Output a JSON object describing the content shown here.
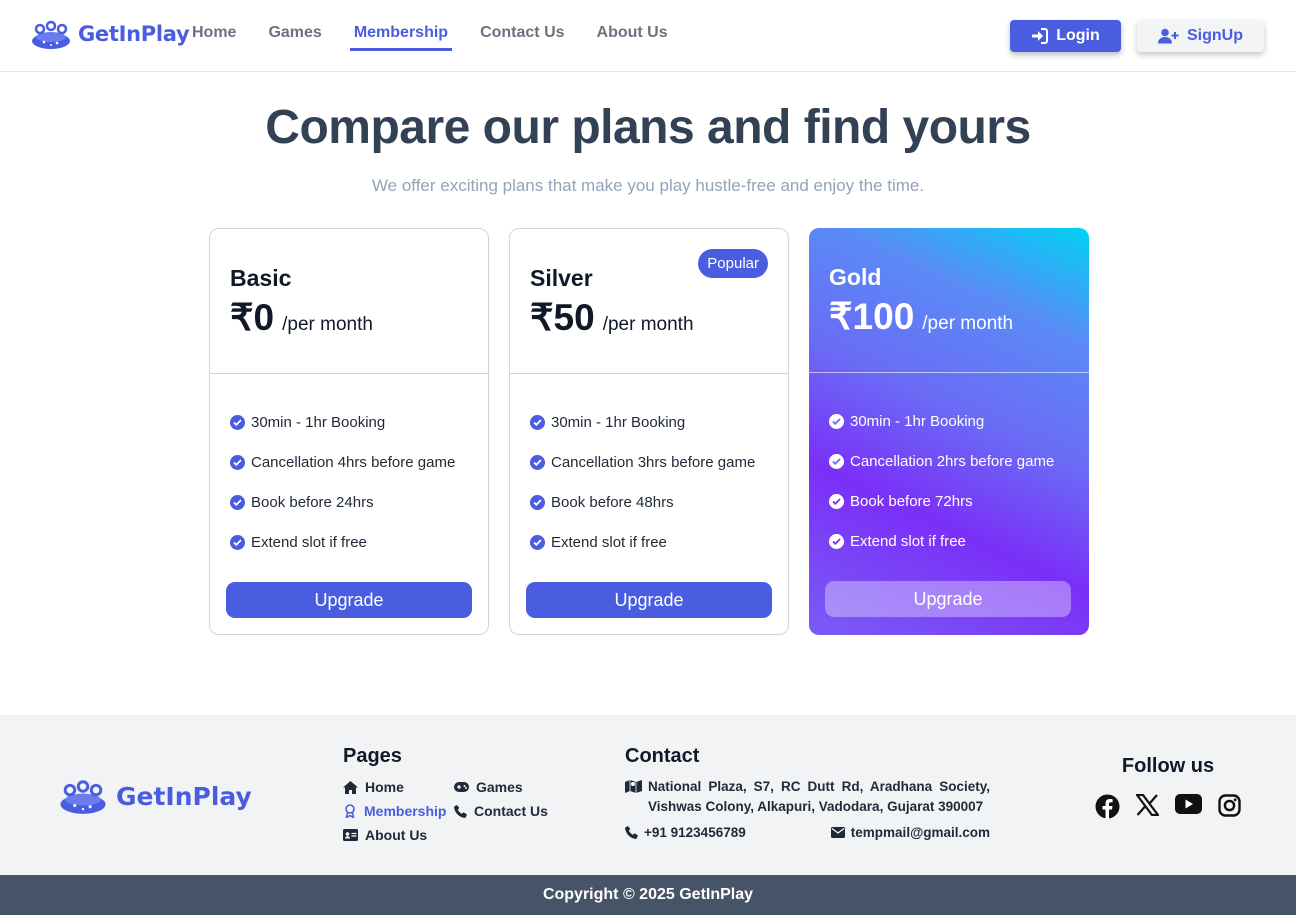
{
  "brand": {
    "name": "GetInPlay"
  },
  "nav": {
    "links": [
      {
        "label": "Home",
        "active": false
      },
      {
        "label": "Games",
        "active": false
      },
      {
        "label": "Membership",
        "active": true
      },
      {
        "label": "Contact Us",
        "active": false
      },
      {
        "label": "About Us",
        "active": false
      }
    ],
    "login_label": "Login",
    "signup_label": "SignUp"
  },
  "hero": {
    "title": "Compare our plans and find yours",
    "subtitle": "We offer exciting plans that make you play hustle-free and enjoy the time."
  },
  "plans": [
    {
      "name": "Basic",
      "price": "₹0",
      "period": "/per month",
      "badge": "",
      "features": [
        "30min - 1hr Booking",
        "Cancellation 4hrs before game",
        "Book before 24hrs",
        "Extend slot if free"
      ],
      "button": "Upgrade"
    },
    {
      "name": "Silver",
      "price": "₹50",
      "period": "/per month",
      "badge": "Popular",
      "features": [
        "30min - 1hr Booking",
        "Cancellation 3hrs before game",
        "Book before 48hrs",
        "Extend slot if free"
      ],
      "button": "Upgrade"
    },
    {
      "name": "Gold",
      "price": "₹100",
      "period": "/per month",
      "badge": "",
      "features": [
        "30min - 1hr Booking",
        "Cancellation 2hrs before game",
        "Book before 72hrs",
        "Extend slot if free"
      ],
      "button": "Upgrade"
    }
  ],
  "footer": {
    "brand_name": "GetInPlay",
    "pages_heading": "Pages",
    "pages": [
      {
        "label": "Home",
        "icon": "home-icon"
      },
      {
        "label": "Games",
        "icon": "gamepad-icon"
      },
      {
        "label": "Membership",
        "icon": "award-icon",
        "active": true
      },
      {
        "label": "Contact Us",
        "icon": "phone-icon"
      },
      {
        "label": "About Us",
        "icon": "id-card-icon"
      }
    ],
    "contact_heading": "Contact",
    "address": "National Plaza, S7, RC Dutt Rd, Aradhana Society, Vishwas Colony, Alkapuri, Vadodara, Gujarat 390007",
    "phone": "+91 9123456789",
    "email": "tempmail@gmail.com",
    "follow_heading": "Follow us",
    "socials": [
      "facebook-icon",
      "x-icon",
      "youtube-icon",
      "instagram-icon"
    ],
    "copyright": "Copyright © 2025 GetInPlay"
  },
  "colors": {
    "accent": "#4a5de0",
    "heading": "#334155",
    "subtitle": "#94a3b8",
    "footer_bg": "#f2f3f5",
    "copyright_bg": "#475467"
  }
}
